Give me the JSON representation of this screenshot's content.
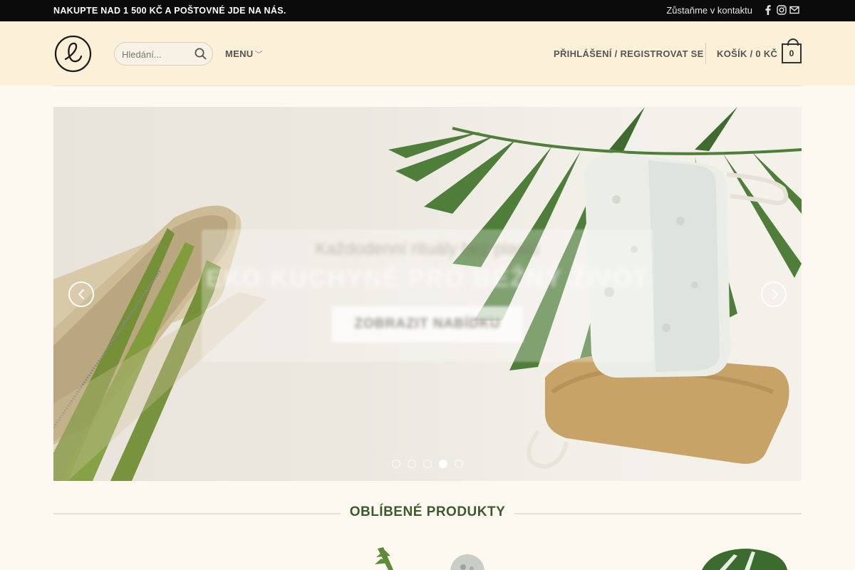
{
  "topbar": {
    "promo": "NAKUPTE NAD 1 500 KČ A POŠTOVNÉ JDE NA NÁS.",
    "contact": "Zůstaňme v kontaktu",
    "social_icons": [
      "facebook-icon",
      "instagram-icon",
      "mail-icon"
    ]
  },
  "header": {
    "logo_icon": "e-circle-logo",
    "search_placeholder": "Hledání...",
    "menu_label": "MENU",
    "login_label": "PŘIHLÁŠENÍ / REGISTROVAT SE",
    "cart_label": "KOŠÍK / 0 KČ",
    "cart_count": "0"
  },
  "slider": {
    "caption_line1": "Každodenní rituály bez plastů",
    "caption_line2": "EKO KUCHYNĚ PRO BĚŽNÝ ŽIVOT",
    "button_label": "ZOBRAZIT NABÍDKU",
    "slide_count": 5,
    "active_slide": 4,
    "prev_icon": "chevron-left-icon",
    "next_icon": "chevron-right-icon"
  },
  "section": {
    "title": "OBLÍBENÉ PRODUKTY"
  },
  "colors": {
    "topbar": "#0b0b0b",
    "header": "#fcf0d8",
    "page": "#fdf8f0",
    "accent_green": "#3c5a2a"
  }
}
